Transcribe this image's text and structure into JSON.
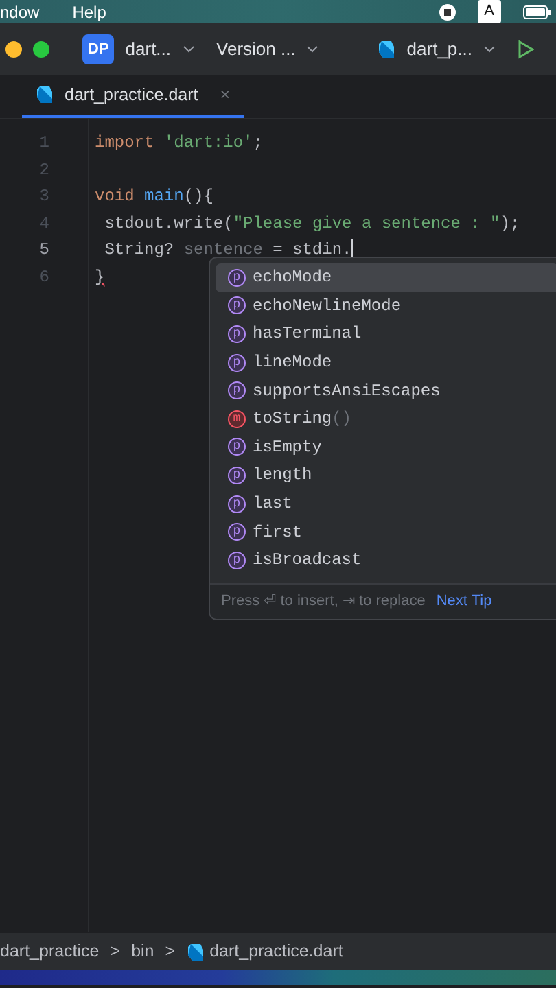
{
  "menu_bar": {
    "items": [
      "ndow",
      "Help"
    ],
    "input_source": "A"
  },
  "title_bar": {
    "project_badge": "DP",
    "project": "dart...",
    "vcs": "Version ...",
    "run_config": "dart_p..."
  },
  "tabs": [
    {
      "label": "dart_practice.dart",
      "selected": true,
      "close": "×"
    }
  ],
  "editor": {
    "lines": [
      {
        "number": "1",
        "current": false,
        "tokens": [
          {
            "text": "import ",
            "kind": "keyword"
          },
          {
            "text": "'dart:io'",
            "kind": "string"
          },
          {
            "text": ";",
            "kind": "plain"
          }
        ]
      },
      {
        "number": "2",
        "current": false
      },
      {
        "number": "3",
        "current": false,
        "tokens": [
          {
            "text": "void ",
            "kind": "keyword"
          },
          {
            "text": "main",
            "kind": "function"
          },
          {
            "text": "(){",
            "kind": "plain"
          }
        ]
      },
      {
        "number": "4",
        "current": false,
        "tokens": [
          {
            "text": " stdout.write(",
            "kind": "plain"
          },
          {
            "text": "\"Please give a sentence : \"",
            "kind": "string"
          },
          {
            "text": ");",
            "kind": "plain"
          }
        ]
      },
      {
        "number": "5",
        "current": true,
        "tokens": [
          {
            "text": " String? ",
            "kind": "plain"
          },
          {
            "text": "sentence",
            "kind": "unused"
          },
          {
            "text": " = stdin.",
            "kind": "plain"
          }
        ]
      },
      {
        "number": "6",
        "current": false,
        "tokens": [
          {
            "text": "}",
            "kind": "error"
          }
        ]
      }
    ]
  },
  "completion": {
    "items": [
      {
        "kind": "property",
        "badge": "p",
        "label": "echoMode",
        "selected": true
      },
      {
        "kind": "property",
        "badge": "p",
        "label": "echoNewlineMode",
        "selected": false
      },
      {
        "kind": "property",
        "badge": "p",
        "label": "hasTerminal",
        "selected": false
      },
      {
        "kind": "property",
        "badge": "p",
        "label": "lineMode",
        "selected": false
      },
      {
        "kind": "property",
        "badge": "p",
        "label": "supportsAnsiEscapes",
        "selected": false
      },
      {
        "kind": "method",
        "badge": "m",
        "label": "toString",
        "suffix": "()",
        "selected": false
      },
      {
        "kind": "property",
        "badge": "p",
        "label": "isEmpty",
        "selected": false
      },
      {
        "kind": "property",
        "badge": "p",
        "label": "length",
        "selected": false
      },
      {
        "kind": "property",
        "badge": "p",
        "label": "last",
        "selected": false
      },
      {
        "kind": "property",
        "badge": "p",
        "label": "first",
        "selected": false
      },
      {
        "kind": "property",
        "badge": "p",
        "label": "isBroadcast",
        "selected": false
      }
    ],
    "hint": "Press ⏎ to insert, ⇥ to replace",
    "tip_link": "Next Tip"
  },
  "breadcrumbs": [
    "dart_practice",
    "bin",
    "dart_practice.dart"
  ],
  "breadcrumb_separator": ">"
}
